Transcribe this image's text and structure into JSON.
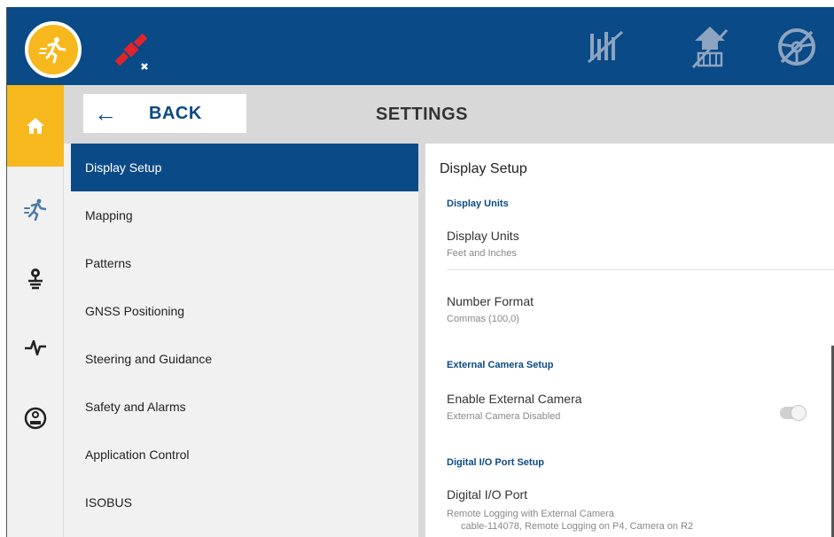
{
  "header": {
    "back_arrow": "←",
    "back_label": "BACK",
    "title": "SETTINGS"
  },
  "menu": {
    "items": [
      {
        "label": "Display Setup",
        "active": true
      },
      {
        "label": "Mapping"
      },
      {
        "label": "Patterns"
      },
      {
        "label": "GNSS Positioning"
      },
      {
        "label": "Steering and Guidance"
      },
      {
        "label": "Safety and Alarms"
      },
      {
        "label": "Application Control"
      },
      {
        "label": "ISOBUS"
      }
    ]
  },
  "detail": {
    "title": "Display Setup",
    "sections": [
      {
        "header": "Display Units",
        "rows": [
          {
            "label": "Display Units",
            "value": "Feet and Inches"
          },
          {
            "label": "Number Format",
            "value": "Commas (100,0)"
          }
        ]
      },
      {
        "header": "External Camera Setup",
        "rows": [
          {
            "label": "Enable External Camera",
            "value": "External Camera Disabled",
            "toggle": false
          }
        ]
      },
      {
        "header": "Digital I/O Port Setup",
        "rows": [
          {
            "label": "Digital I/O Port",
            "value": "Remote Logging with External Camera",
            "value2": "cable-114078, Remote Logging on P4, Camera on R2"
          }
        ]
      }
    ]
  },
  "colors": {
    "brand_blue": "#0a4a86",
    "accent_yellow": "#f6b81d",
    "gps_red": "#e0242b"
  },
  "icons": {
    "topbar": [
      "autosteer-icon",
      "gps-satellite-icon",
      "field-boundary-icon",
      "section-control-icon",
      "steering-wheel-disabled-icon"
    ],
    "leftnav": [
      "home-icon",
      "autosteer-icon",
      "implement-icon",
      "diagnostics-pulse-icon",
      "vdt-icon"
    ]
  }
}
